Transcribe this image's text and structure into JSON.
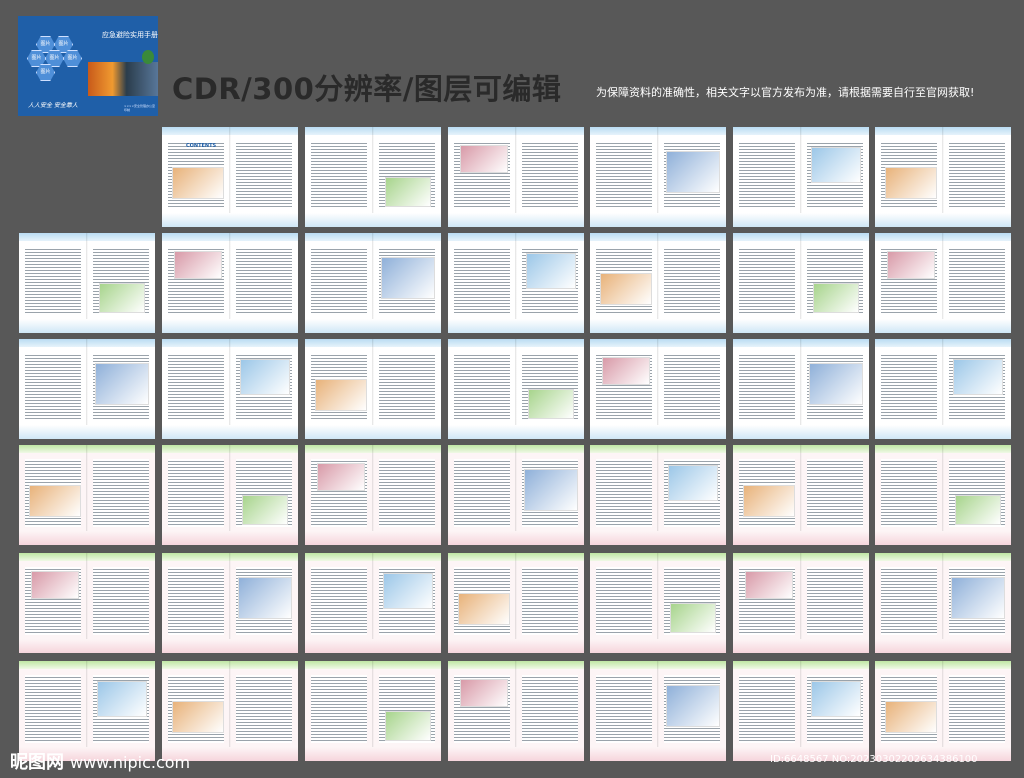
{
  "cover": {
    "title": "应急避险实用手册",
    "hex_labels": [
      "图片",
      "图片",
      "图片",
      "图片",
      "图片",
      "图片"
    ],
    "motto": "人人安全  安全靠人",
    "footer": "××××安全管理办公室  印制"
  },
  "headline": "CDR/300分辨率/图层可编辑",
  "subline": "为保障资料的准确性，相关文字以官方发布为准，请根据需要自行至官网获取!",
  "contents_label": "CONTENTS",
  "watermark": {
    "brand": "昵图网",
    "url": "www.nipic.com"
  },
  "id_line": "ID:6648567 NO:20230302202634386100",
  "page_rows": [
    {
      "style": "blue",
      "count": 6
    },
    {
      "style": "blue",
      "count": 7
    },
    {
      "style": "blue",
      "count": 7
    },
    {
      "style": "pink",
      "count": 7
    },
    {
      "style": "pink",
      "count": 7
    },
    {
      "style": "pink",
      "count": 7
    }
  ],
  "palette": {
    "background": "#585858",
    "cover": "#1f5fa8",
    "header_blue": "#b9dcf2",
    "footer_pink": "#f6d5dc"
  }
}
